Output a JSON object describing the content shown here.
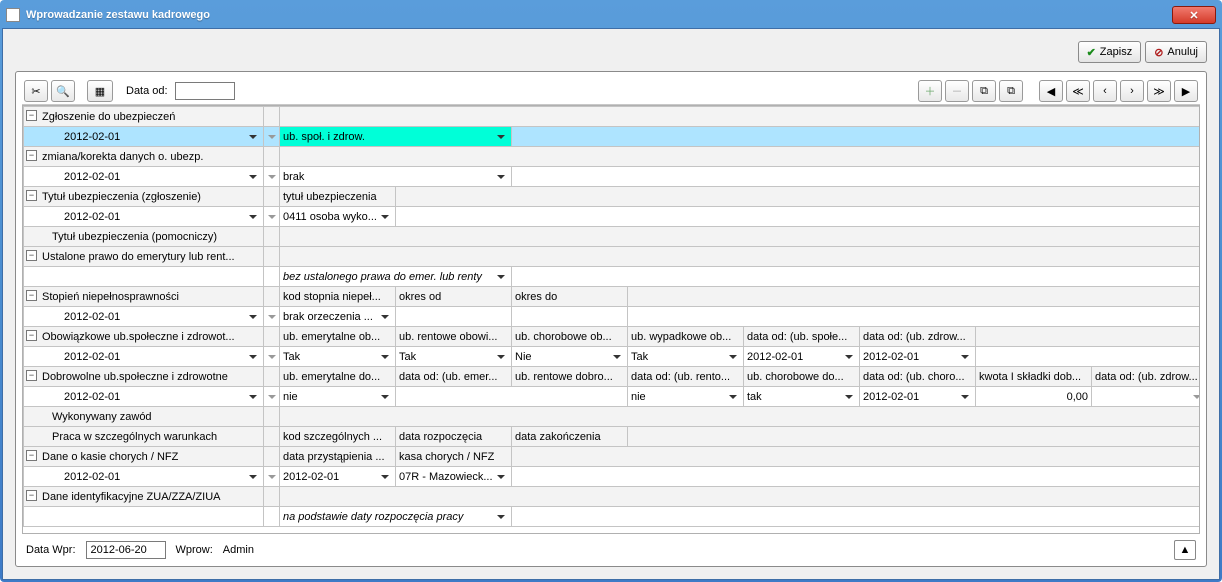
{
  "window": {
    "title": "Wprowadzanie zestawu kadrowego"
  },
  "buttons": {
    "save": "Zapisz",
    "cancel": "Anuluj"
  },
  "toolbar": {
    "date_from_label": "Data od:",
    "date_from_value": ""
  },
  "sections": {
    "zgloszenie": {
      "label": "Zgłoszenie do ubezpieczeń",
      "date": "2012-02-01",
      "value": "ub. społ. i zdrow."
    },
    "zmiana": {
      "label": "zmiana/korekta danych o. ubezp.",
      "date": "2012-02-01",
      "value": "brak"
    },
    "tytul": {
      "label": "Tytuł ubezpieczenia (zgłoszenie)",
      "header": "tytuł ubezpieczenia",
      "date": "2012-02-01",
      "value": "0411 osoba wyko..."
    },
    "tytul_pom": {
      "label": "Tytuł ubezpieczenia (pomocniczy)"
    },
    "prawo": {
      "label": "Ustalone prawo do emerytury lub rent...",
      "value": "bez ustalonego prawa do emer. lub renty"
    },
    "stopien": {
      "label": "Stopień niepełnosprawności",
      "header1": "kod stopnia niepeł...",
      "header2": "okres od",
      "header3": "okres do",
      "date": "2012-02-01",
      "value": "brak orzeczenia ..."
    },
    "obow": {
      "label": "Obowiązkowe ub.społeczne i zdrowot...",
      "h1": "ub. emerytalne ob...",
      "h2": "ub. rentowe obowi...",
      "h3": "ub. chorobowe ob...",
      "h4": "ub. wypadkowe ob...",
      "h5": "data od: (ub. społe...",
      "h6": "data od: (ub. zdrow...",
      "date": "2012-02-01",
      "v1": "Tak",
      "v2": "Tak",
      "v3": "Nie",
      "v4": "Tak",
      "v5": "2012-02-01",
      "v6": "2012-02-01"
    },
    "dobr": {
      "label": "Dobrowolne ub.społeczne i zdrowotne",
      "h1": "ub. emerytalne do...",
      "h2": "data od: (ub. emer...",
      "h3": "ub. rentowe dobro...",
      "h4": "data od: (ub. rento...",
      "h5": "ub. chorobowe do...",
      "h6": "data od: (ub. choro...",
      "h7": "kwota I składki dob...",
      "h8": "data od: (ub. zdrow...",
      "date": "2012-02-01",
      "v1": "nie",
      "v2": "",
      "v3": "nie",
      "v4": "",
      "v5": "tak",
      "v6": "2012-02-01",
      "v7": "0,00",
      "v8": ""
    },
    "zawod": {
      "label": "Wykonywany zawód"
    },
    "praca": {
      "label": "Praca w szczególnych warunkach",
      "h1": "kod szczególnych ...",
      "h2": "data rozpoczęcia",
      "h3": "data zakończenia"
    },
    "nfz": {
      "label": "Dane o kasie chorych / NFZ",
      "h1": "data przystąpienia ...",
      "h2": "kasa chorych / NFZ",
      "date": "2012-02-01",
      "v1": "2012-02-01",
      "v2": "07R - Mazowieck..."
    },
    "ident": {
      "label": "Dane identyfikacyjne ZUA/ZZA/ZIUA",
      "value": "na podstawie daty rozpoczęcia pracy"
    }
  },
  "status": {
    "data_wpr_label": "Data Wpr:",
    "data_wpr": "2012-06-20",
    "wprow_label": "Wprow:",
    "wprow": "Admin"
  }
}
